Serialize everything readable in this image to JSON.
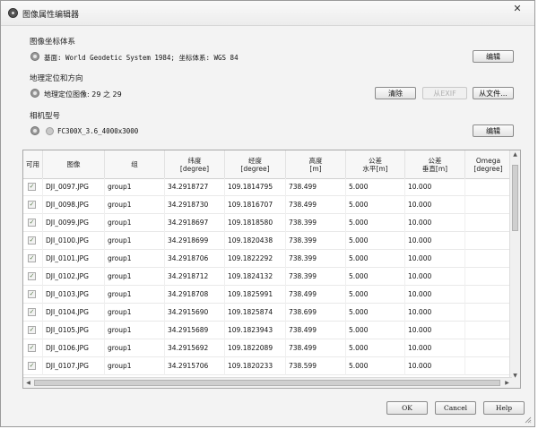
{
  "window": {
    "title": "图像属性编辑器",
    "close_glyph": "✕"
  },
  "sections": {
    "coords": {
      "label": "图像坐标体系",
      "value": "基面: World Geodetic System 1984; 坐标体系: WGS 84",
      "edit_label": "编辑"
    },
    "geo": {
      "label": "地理定位和方向",
      "value": "地理定位图像: 29 之 29",
      "clear_label": "清除",
      "exif_label": "从EXIF",
      "file_label": "从文件..."
    },
    "camera": {
      "label": "相机型号",
      "value": "FC300X_3.6_4000x3000",
      "edit_label": "编辑"
    }
  },
  "table": {
    "columns": [
      {
        "label": "可用"
      },
      {
        "label": "图像"
      },
      {
        "label": "组"
      },
      {
        "label": "纬度\n[degree]"
      },
      {
        "label": "经度\n[degree]"
      },
      {
        "label": "高度\n[m]"
      },
      {
        "label": "公差\n水平[m]"
      },
      {
        "label": "公差\n垂直[m]"
      },
      {
        "label": "Omega\n[degree]"
      }
    ],
    "rows": [
      {
        "image": "DJI_0097.JPG",
        "group": "group1",
        "lat": "34.2918727",
        "lon": "109.1814795",
        "alt": "738.499",
        "tol_h": "5.000",
        "tol_v": "10.000",
        "omega": ""
      },
      {
        "image": "DJI_0098.JPG",
        "group": "group1",
        "lat": "34.2918730",
        "lon": "109.1816707",
        "alt": "738.499",
        "tol_h": "5.000",
        "tol_v": "10.000",
        "omega": ""
      },
      {
        "image": "DJI_0099.JPG",
        "group": "group1",
        "lat": "34.2918697",
        "lon": "109.1818580",
        "alt": "738.399",
        "tol_h": "5.000",
        "tol_v": "10.000",
        "omega": ""
      },
      {
        "image": "DJI_0100.JPG",
        "group": "group1",
        "lat": "34.2918699",
        "lon": "109.1820438",
        "alt": "738.399",
        "tol_h": "5.000",
        "tol_v": "10.000",
        "omega": ""
      },
      {
        "image": "DJI_0101.JPG",
        "group": "group1",
        "lat": "34.2918706",
        "lon": "109.1822292",
        "alt": "738.399",
        "tol_h": "5.000",
        "tol_v": "10.000",
        "omega": ""
      },
      {
        "image": "DJI_0102.JPG",
        "group": "group1",
        "lat": "34.2918712",
        "lon": "109.1824132",
        "alt": "738.399",
        "tol_h": "5.000",
        "tol_v": "10.000",
        "omega": ""
      },
      {
        "image": "DJI_0103.JPG",
        "group": "group1",
        "lat": "34.2918708",
        "lon": "109.1825991",
        "alt": "738.499",
        "tol_h": "5.000",
        "tol_v": "10.000",
        "omega": ""
      },
      {
        "image": "DJI_0104.JPG",
        "group": "group1",
        "lat": "34.2915690",
        "lon": "109.1825874",
        "alt": "738.699",
        "tol_h": "5.000",
        "tol_v": "10.000",
        "omega": ""
      },
      {
        "image": "DJI_0105.JPG",
        "group": "group1",
        "lat": "34.2915689",
        "lon": "109.1823943",
        "alt": "738.499",
        "tol_h": "5.000",
        "tol_v": "10.000",
        "omega": ""
      },
      {
        "image": "DJI_0106.JPG",
        "group": "group1",
        "lat": "34.2915692",
        "lon": "109.1822089",
        "alt": "738.499",
        "tol_h": "5.000",
        "tol_v": "10.000",
        "omega": ""
      },
      {
        "image": "DJI_0107.JPG",
        "group": "group1",
        "lat": "34.2915706",
        "lon": "109.1820233",
        "alt": "738.599",
        "tol_h": "5.000",
        "tol_v": "10.000",
        "omega": ""
      }
    ],
    "check_glyph": "✓",
    "arrows": {
      "up": "▲",
      "down": "▼",
      "left": "◀",
      "right": "▶"
    }
  },
  "footer": {
    "ok_label": "OK",
    "cancel_label": "Cancel",
    "help_label": "Help"
  }
}
